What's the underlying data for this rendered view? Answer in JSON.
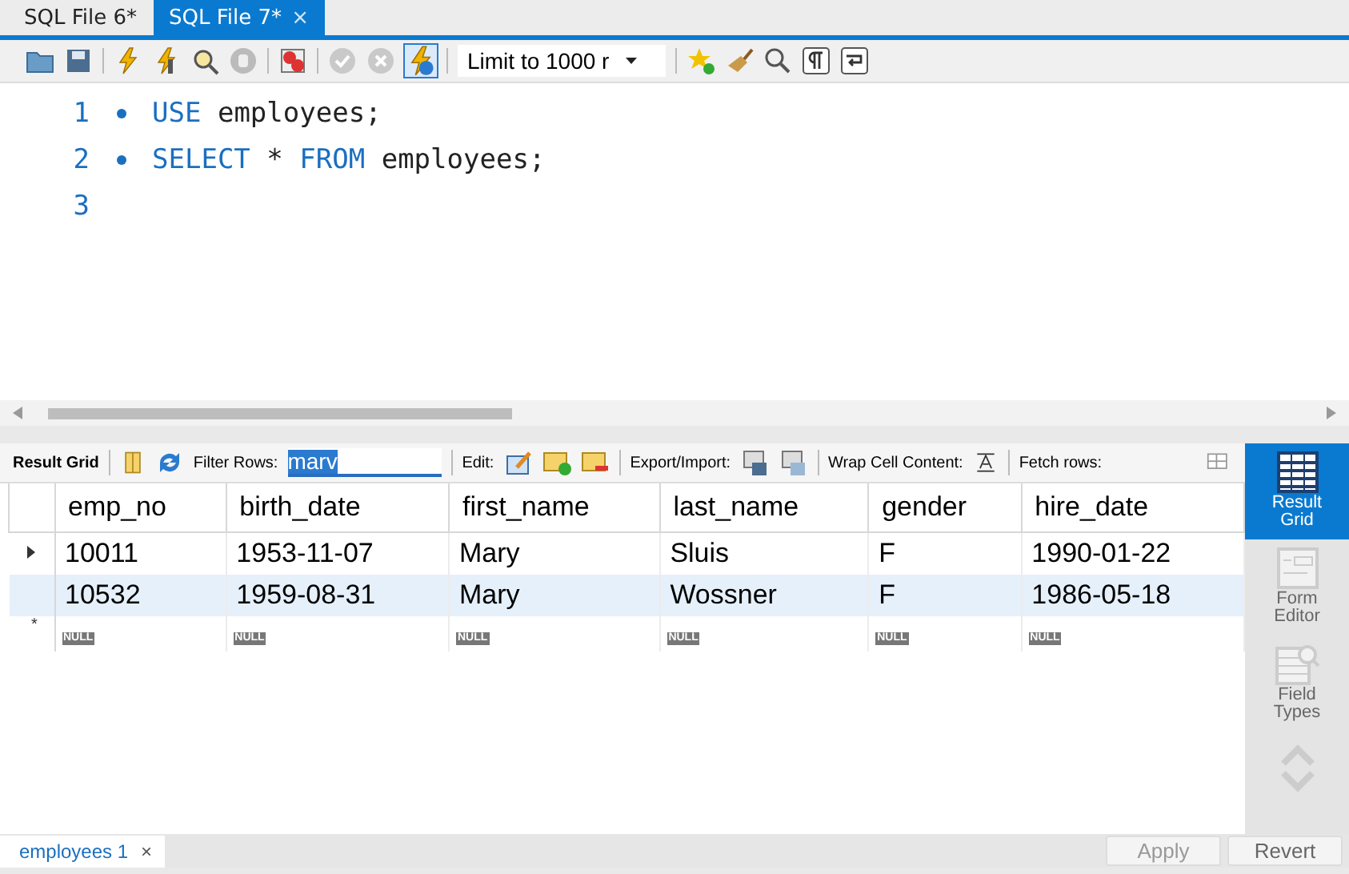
{
  "tabs": [
    {
      "label": "SQL File 6*",
      "selected": false
    },
    {
      "label": "SQL File 7*",
      "selected": true,
      "close": "×"
    }
  ],
  "toolbar": {
    "limit": "Limit to 1000 r"
  },
  "editor": {
    "lines": [
      {
        "number": "1",
        "marker": true,
        "tokens": [
          {
            "text": "USE",
            "kind": "keyword"
          },
          {
            "text": " employees;",
            "kind": "plain"
          }
        ]
      },
      {
        "number": "2",
        "marker": true,
        "tokens": [
          {
            "text": "SELECT",
            "kind": "keyword"
          },
          {
            "text": " * ",
            "kind": "plain"
          },
          {
            "text": "FROM",
            "kind": "keyword"
          },
          {
            "text": " employees;",
            "kind": "plain"
          }
        ]
      },
      {
        "number": "3",
        "marker": false
      }
    ]
  },
  "result_toolbar": {
    "title": "Result Grid",
    "filter_label": "Filter Rows:",
    "filter_value": "marv",
    "edit_label": "Edit:",
    "export_label": "Export/Import:",
    "wrap_label": "Wrap Cell Content:",
    "fetch_label": "Fetch rows:"
  },
  "grid": {
    "columns": [
      "emp_no",
      "birth_date",
      "first_name",
      "last_name",
      "gender",
      "hire_date"
    ],
    "rows": [
      {
        "current": true,
        "selected": false,
        "cells": [
          "10011",
          "1953-11-07",
          "Mary",
          "Sluis",
          "F",
          "1990-01-22"
        ]
      },
      {
        "current": false,
        "selected": true,
        "cells": [
          "10532",
          "1959-08-31",
          "Mary",
          "Wossner",
          "F",
          "1986-05-18"
        ]
      }
    ],
    "new_row": {
      "marker": "*",
      "nulls": [
        "NULL",
        "NULL",
        "NULL",
        "NULL",
        "NULL",
        "NULL"
      ]
    }
  },
  "side_panel": [
    {
      "label": "Result Grid",
      "selected": true,
      "kind": "grid"
    },
    {
      "label": "Form Editor",
      "selected": false,
      "kind": "form"
    },
    {
      "label": "Field Types",
      "selected": false,
      "kind": "types"
    }
  ],
  "bottom": {
    "result_tab": "employees 1",
    "result_tab_close": "×",
    "buttons": [
      {
        "label": "Apply",
        "disabled": true
      },
      {
        "label": "Revert",
        "disabled": false
      }
    ]
  }
}
